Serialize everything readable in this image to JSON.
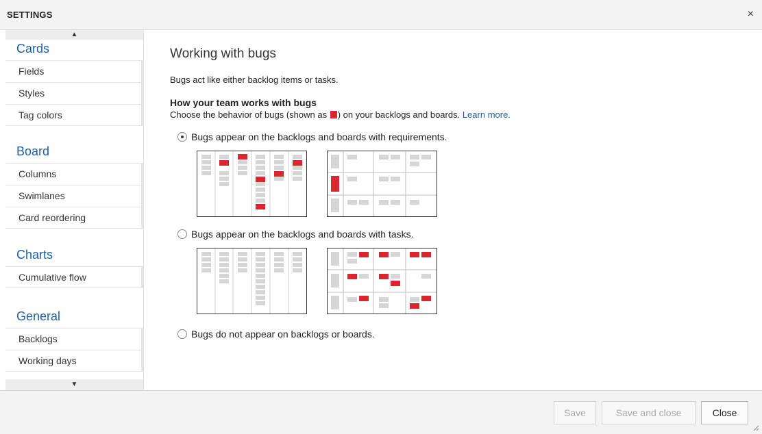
{
  "dialog": {
    "title": "SETTINGS",
    "close_glyph": "×"
  },
  "sidebar": {
    "scroll_up": "▲",
    "scroll_down": "▼",
    "groups": [
      {
        "heading": "Cards",
        "items": [
          "Fields",
          "Styles",
          "Tag colors"
        ]
      },
      {
        "heading": "Board",
        "items": [
          "Columns",
          "Swimlanes",
          "Card reordering"
        ]
      },
      {
        "heading": "Charts",
        "items": [
          "Cumulative flow"
        ]
      },
      {
        "heading": "General",
        "items": [
          "Backlogs",
          "Working days"
        ]
      }
    ]
  },
  "main": {
    "title": "Working with bugs",
    "intro": "Bugs act like either backlog items or tasks.",
    "subheading": "How your team works with bugs",
    "description_before": "Choose the behavior of bugs (shown as ",
    "description_after": ") on your backlogs and boards.",
    "learn_more": "Learn more.",
    "options": [
      {
        "label": "Bugs appear on the backlogs and boards with requirements.",
        "selected": true
      },
      {
        "label": "Bugs appear on the backlogs and boards with tasks.",
        "selected": false
      },
      {
        "label": "Bugs do not appear on backlogs or boards.",
        "selected": false
      }
    ]
  },
  "footer": {
    "save": "Save",
    "save_and_close": "Save and close",
    "close": "Close"
  },
  "colors": {
    "accent": "#1e5fa8",
    "bug": "#d9262f",
    "card": "#d6d6d6"
  }
}
